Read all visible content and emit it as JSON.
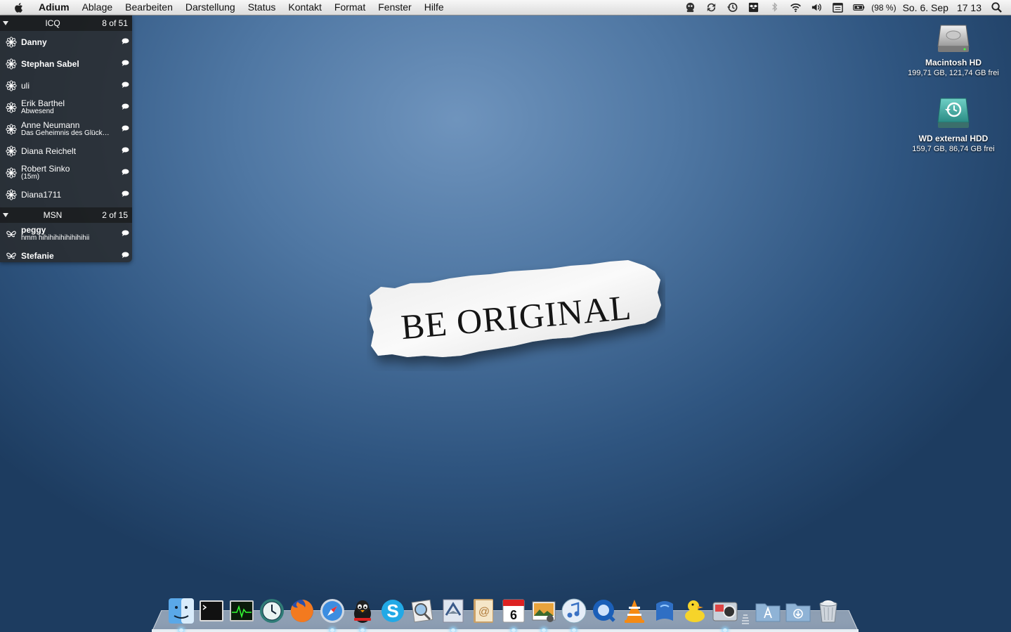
{
  "menubar": {
    "app_name": "Adium",
    "items": [
      "Ablage",
      "Bearbeiten",
      "Darstellung",
      "Status",
      "Kontakt",
      "Format",
      "Fenster",
      "Hilfe"
    ],
    "battery": "(98 %)",
    "date": "So. 6. Sep",
    "time": "17 13",
    "icons": [
      "apple-icon",
      "adium-status-icon",
      "sync-icon",
      "time-machine-icon",
      "dropbox-icon",
      "bluetooth-icon",
      "wifi-icon",
      "volume-icon",
      "calendar-icon",
      "battery-icon",
      "spotlight-icon"
    ]
  },
  "contacts": {
    "groups": [
      {
        "name": "ICQ",
        "count": "8 of 51",
        "service_icon": "icq-flower-icon",
        "contacts": [
          {
            "name": "Danny",
            "status": "",
            "bold": true
          },
          {
            "name": "Stephan Sabel",
            "status": "",
            "bold": true
          },
          {
            "name": "uli",
            "status": "",
            "bold": false
          },
          {
            "name": "Erik Barthel",
            "status": "Abwesend",
            "bold": false
          },
          {
            "name": "Anne Neumann",
            "status": "Das Geheimnis des Glück…",
            "bold": false
          },
          {
            "name": "Diana Reichelt",
            "status": "",
            "bold": false
          },
          {
            "name": "Robert Sinko",
            "status": "(15m)",
            "bold": false
          },
          {
            "name": "Diana1711",
            "status": "",
            "bold": false
          }
        ]
      },
      {
        "name": "MSN",
        "count": "2 of 15",
        "service_icon": "msn-butterfly-icon",
        "contacts": [
          {
            "name": "peggy",
            "status": "hmm hihihihihihihihihii",
            "bold": true
          },
          {
            "name": "Stefanie",
            "status": "",
            "bold": true
          }
        ]
      }
    ]
  },
  "desktop": {
    "drives": [
      {
        "name": "Macintosh HD",
        "info": "199,71 GB, 121,74 GB frei",
        "icon": "hard-disk-icon"
      },
      {
        "name": "WD external HDD",
        "info": "159,7 GB, 86,74 GB frei",
        "icon": "time-machine-disk-icon"
      }
    ],
    "wallpaper_text": "BE ORIGINAL"
  },
  "dock": {
    "apps": [
      {
        "name": "finder-icon",
        "running": true
      },
      {
        "name": "terminal-icon",
        "running": false
      },
      {
        "name": "activity-monitor-icon",
        "running": false
      },
      {
        "name": "time-machine-icon",
        "running": false
      },
      {
        "name": "firefox-icon",
        "running": false
      },
      {
        "name": "safari-icon",
        "running": true
      },
      {
        "name": "adium-icon",
        "running": true
      },
      {
        "name": "skype-icon",
        "running": false
      },
      {
        "name": "preview-icon",
        "running": false
      },
      {
        "name": "mail-icon",
        "running": true
      },
      {
        "name": "address-book-icon",
        "running": false
      },
      {
        "name": "ical-icon",
        "running": true
      },
      {
        "name": "iphoto-icon",
        "running": true
      },
      {
        "name": "itunes-icon",
        "running": true
      },
      {
        "name": "quicktime-icon",
        "running": false
      },
      {
        "name": "vlc-icon",
        "running": false
      },
      {
        "name": "sweetfm-icon",
        "running": false
      },
      {
        "name": "cyberduck-icon",
        "running": false
      },
      {
        "name": "photo-booth-icon",
        "running": true
      }
    ],
    "stacks": [
      "applications-stack-icon",
      "downloads-stack-icon",
      "trash-icon"
    ],
    "ical_day": "6",
    "colors": {
      "running_indicator": "#8fd8ff"
    }
  }
}
